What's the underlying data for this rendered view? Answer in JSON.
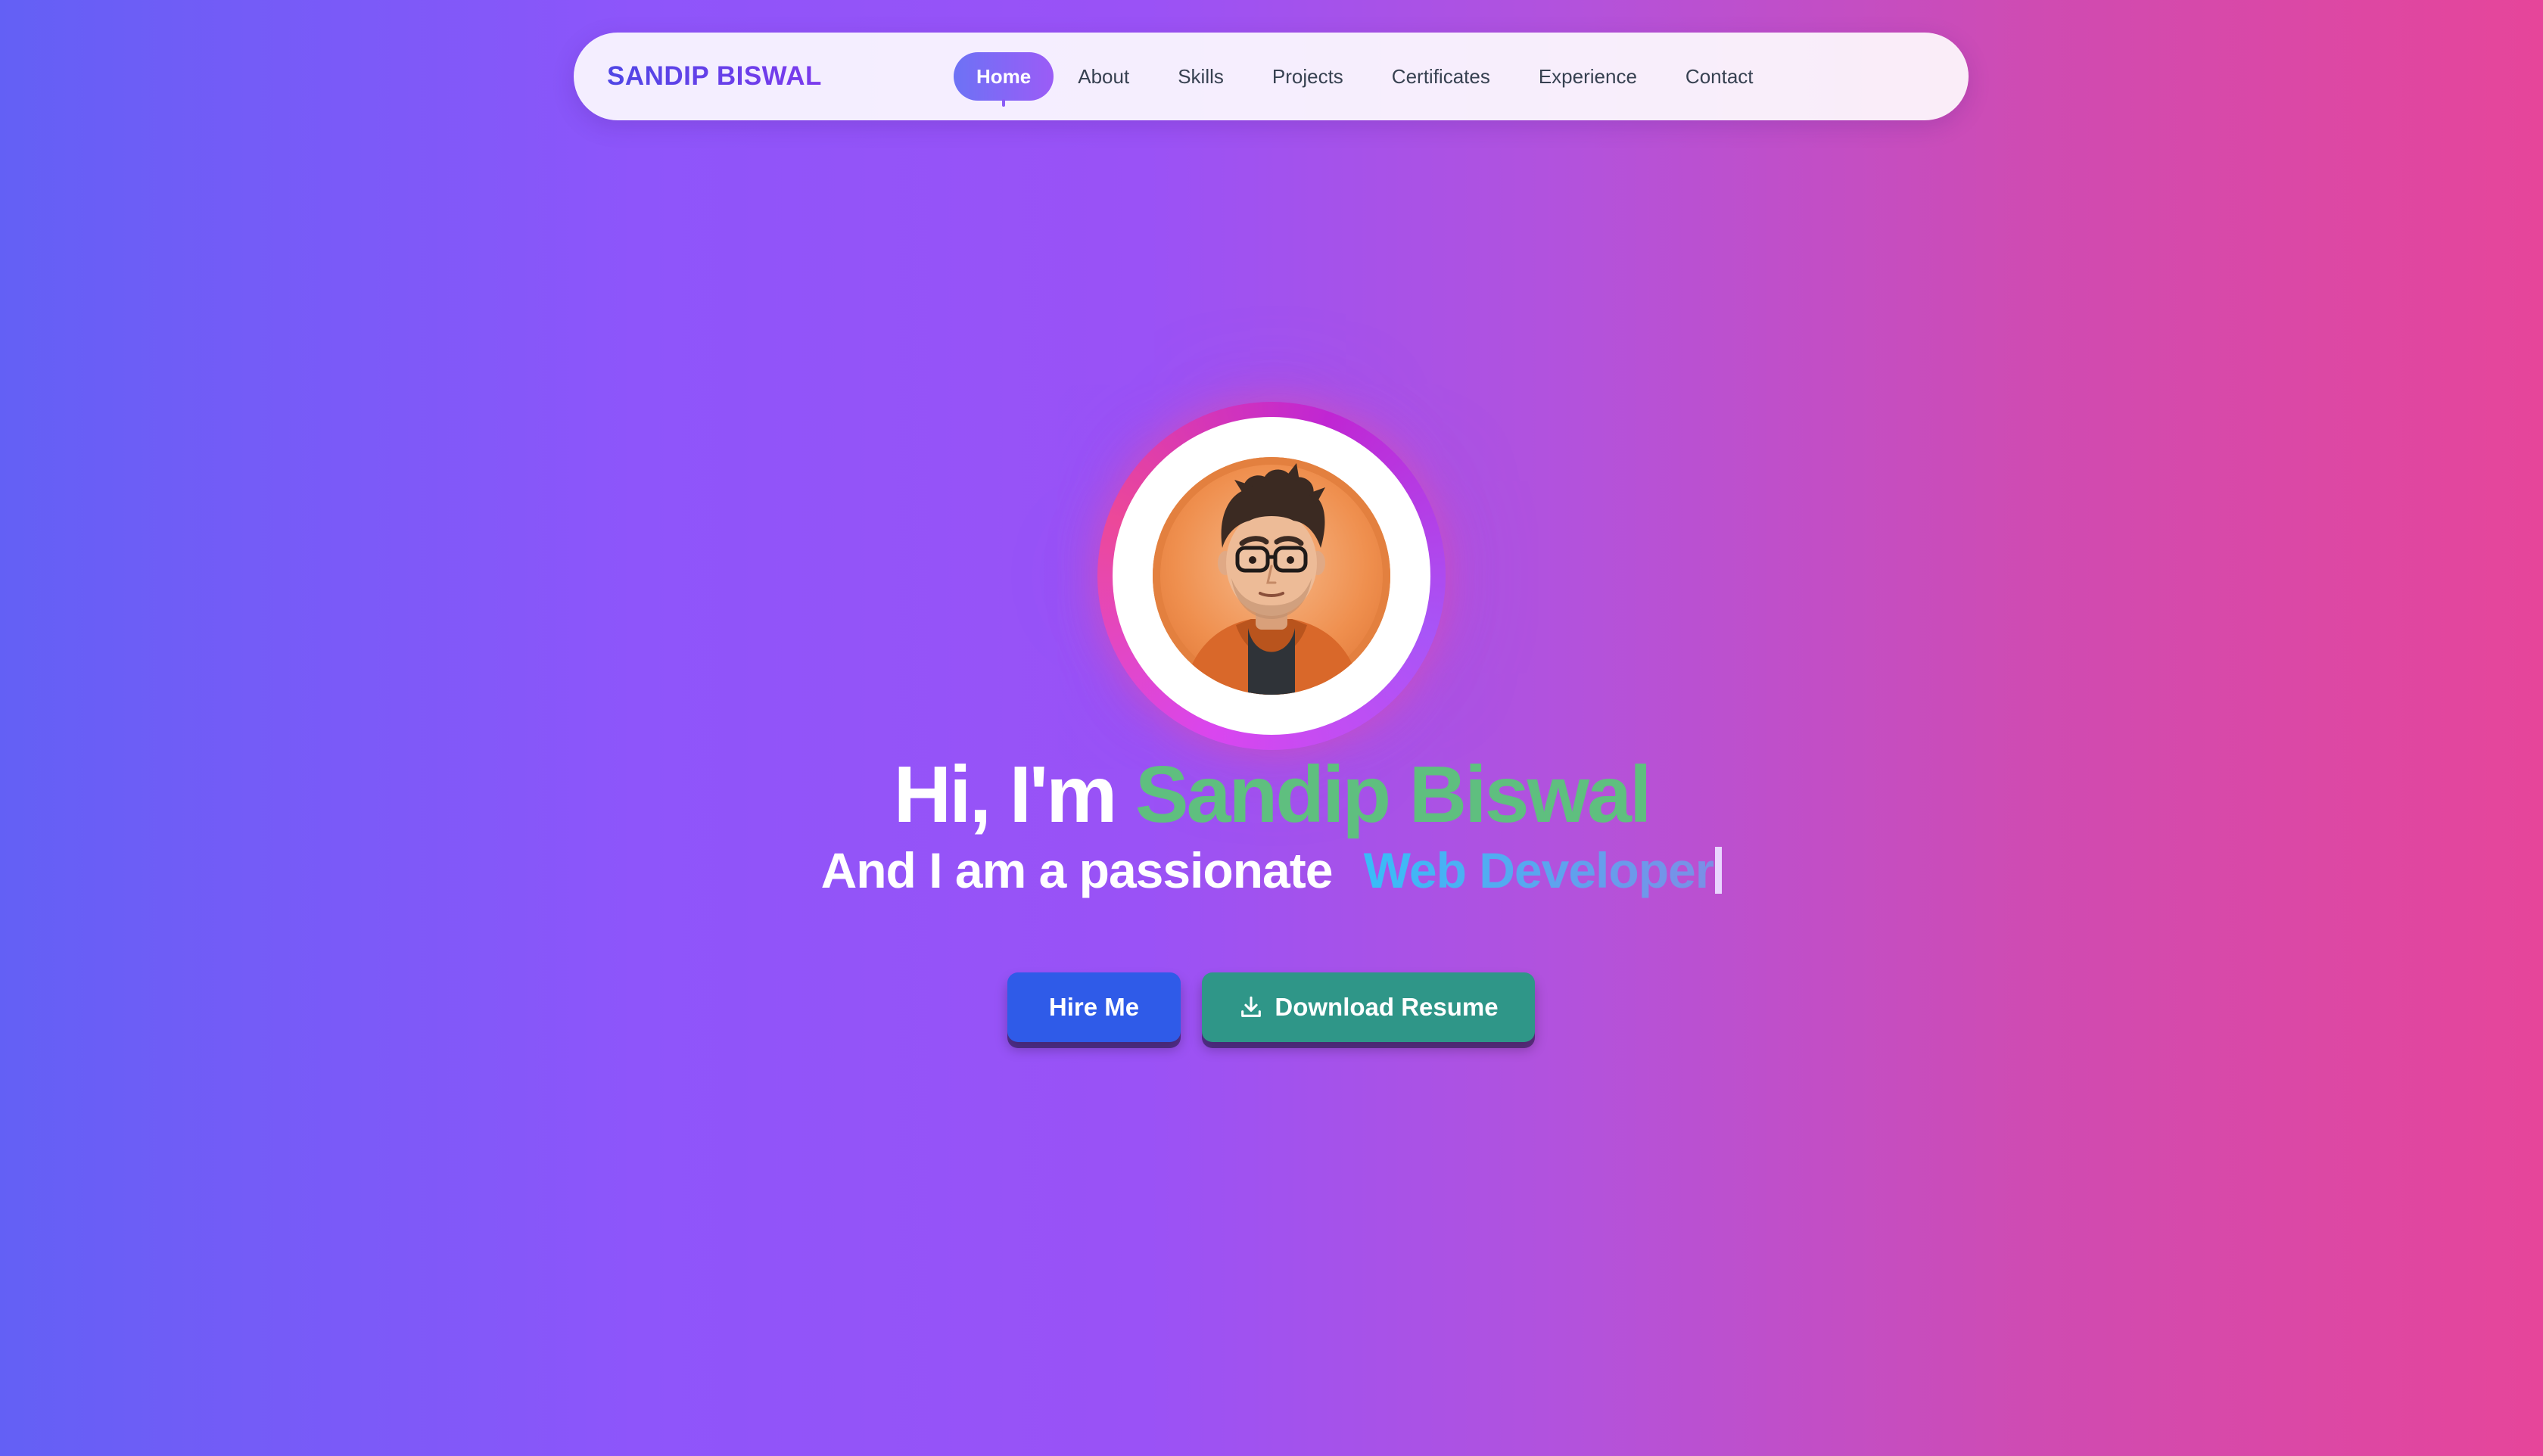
{
  "brand": "SANDIP BISWAL",
  "nav": {
    "items": [
      {
        "label": "Home",
        "active": true
      },
      {
        "label": "About"
      },
      {
        "label": "Skills"
      },
      {
        "label": "Projects"
      },
      {
        "label": "Certificates"
      },
      {
        "label": "Experience"
      },
      {
        "label": "Contact"
      }
    ]
  },
  "hero": {
    "greeting": "Hi, I'm",
    "name": "Sandip Biswal",
    "subtitle_prefix": "And I am a passionate",
    "role": "Web Developer",
    "avatar_icon": "developer-avatar-icon"
  },
  "buttons": {
    "hire": "Hire Me",
    "resume": "Download Resume",
    "resume_icon": "download-icon"
  },
  "colors": {
    "name_green": "#5fbf7f",
    "hire_blue": "#2f5be8",
    "resume_teal": "#2f9688"
  }
}
